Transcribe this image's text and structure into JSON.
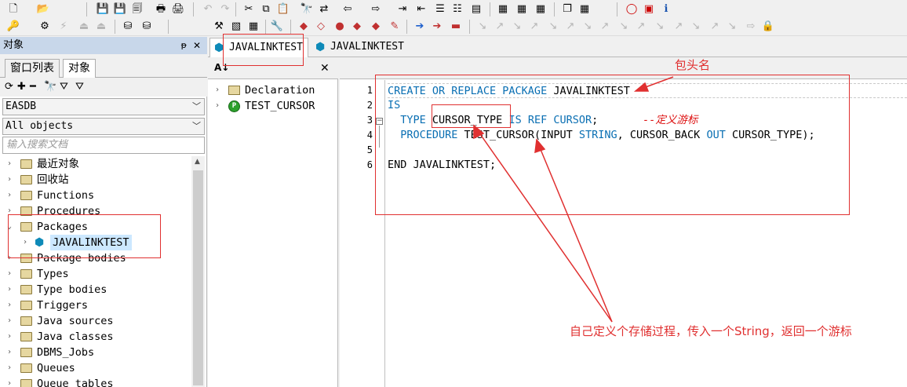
{
  "toolbar_row1": {
    "icons": [
      "new-icon",
      "open-icon",
      "save-icon",
      "save-all-icon",
      "save-as-icon",
      "print-icon",
      "print-setup-icon",
      "undo-icon",
      "redo-icon",
      "cut-icon",
      "copy-icon",
      "paste-icon",
      "find-icon",
      "replace-icon",
      "comment-icon",
      "uncomment-icon",
      "indent-icon",
      "outdent-icon",
      "execute-icon",
      "explain-icon",
      "describe-icon",
      "window-list-icon",
      "tile-icon",
      "oracle-icon",
      "pdf-icon",
      "info-icon"
    ]
  },
  "left_panel": {
    "title": "对象",
    "pin": "ᵽ",
    "close": "✕",
    "tabs": [
      {
        "label": "窗口列表"
      },
      {
        "label": "对象"
      }
    ],
    "connection": "EASDB",
    "filter": "All objects",
    "search_placeholder": "输入搜索文档",
    "tree": [
      {
        "label": "最近对象"
      },
      {
        "label": "回收站"
      },
      {
        "label": "Functions"
      },
      {
        "label": "Procedures"
      },
      {
        "label": "Packages",
        "expanded": true
      },
      {
        "label": "JAVALINKTEST",
        "child": true,
        "selected": true
      },
      {
        "label": "Package bodies"
      },
      {
        "label": "Types"
      },
      {
        "label": "Type bodies"
      },
      {
        "label": "Triggers"
      },
      {
        "label": "Java sources"
      },
      {
        "label": "Java classes"
      },
      {
        "label": "DBMS_Jobs"
      },
      {
        "label": "Queues"
      },
      {
        "label": "Queue tables"
      }
    ]
  },
  "doc_tabs": [
    {
      "label": "JAVALINKTEST",
      "active": true
    },
    {
      "label": "JAVALINKTEST",
      "active": false
    }
  ],
  "structure": {
    "items": [
      {
        "label": "Declaration"
      },
      {
        "label": "TEST_CURSOR"
      }
    ]
  },
  "editor": {
    "line_numbers": [
      "1",
      "2",
      "3",
      "4",
      "5",
      "6"
    ],
    "lines": {
      "l1_kw": "CREATE OR REPLACE PACKAGE",
      "l1_name": " JAVALINKTEST",
      "l2_kw": "IS",
      "l3_indent": "  ",
      "l3_kw1": "TYPE",
      "l3_name": " CURSOR_TYPE ",
      "l3_kw2": "IS REF CURSOR",
      "l3_semi": ";",
      "l3_pad": "       ",
      "l3_comment": "--定义游标",
      "l4_indent": "  ",
      "l4_kw1": "PROCEDURE",
      "l4_a": " TEST_CURSOR(INPUT ",
      "l4_kw2": "STRING",
      "l4_b": ", CURSOR_BACK ",
      "l4_kw3": "OUT",
      "l4_c": " CURSOR_TYPE);",
      "l6_kw": "END",
      "l6_rest": " JAVALINKTEST;"
    }
  },
  "annotations": {
    "package_header_note": "包头名",
    "procedure_note": "自己定义个存储过程，传入一个String，返回一个游标",
    "color": "#e03030"
  }
}
